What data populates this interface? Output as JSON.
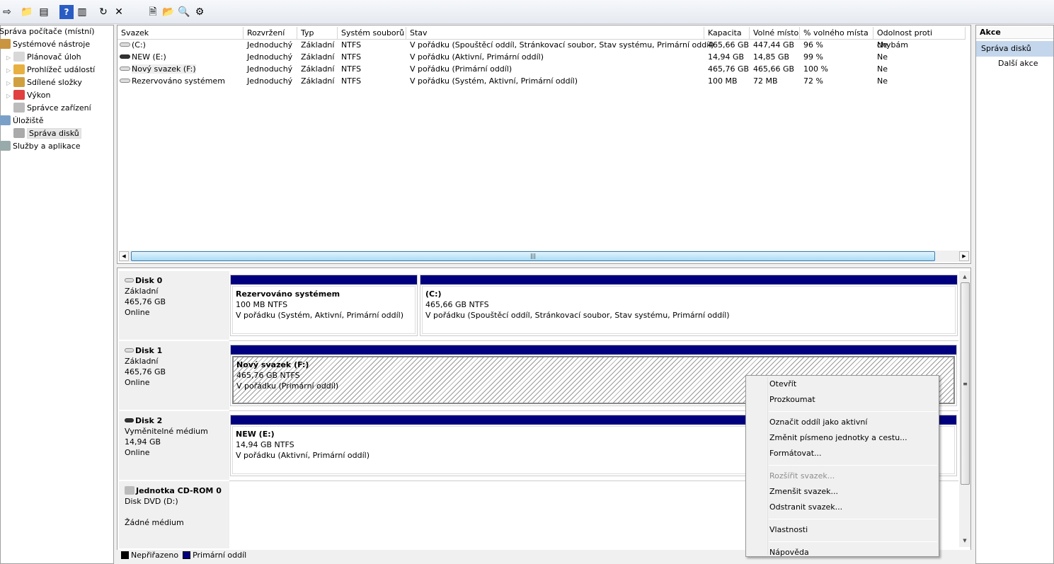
{
  "toolbar": {
    "icons": [
      "forward-arrow-icon",
      "up-folder-icon",
      "show-hide-tree-icon",
      "help-icon",
      "show-hide-action-pane-icon",
      "refresh-icon",
      "delete-icon",
      "properties-icon",
      "open-icon",
      "explore-icon",
      "settings-icon"
    ]
  },
  "tree": {
    "items": [
      {
        "label": "Správa počítače (místní)",
        "level": 0
      },
      {
        "label": "Systémové nástroje",
        "level": 1
      },
      {
        "label": "Plánovač úloh",
        "level": 2,
        "expandable": true
      },
      {
        "label": "Prohlížeč událostí",
        "level": 2,
        "expandable": true
      },
      {
        "label": "Sdílené složky",
        "level": 2,
        "expandable": true
      },
      {
        "label": "Výkon",
        "level": 2,
        "expandable": true
      },
      {
        "label": "Správce zařízení",
        "level": 2
      },
      {
        "label": "Úložiště",
        "level": 1
      },
      {
        "label": "Správa disků",
        "level": 2,
        "selected": true
      },
      {
        "label": "Služby a aplikace",
        "level": 1
      }
    ]
  },
  "volumes": {
    "columns": [
      "Svazek",
      "Rozvržení",
      "Typ",
      "Systém souborů",
      "Stav",
      "Kapacita",
      "Volné místo",
      "% volného místa",
      "Odolnost proti chybám"
    ],
    "rows": [
      [
        "(C:)",
        "Jednoduchý",
        "Základní",
        "NTFS",
        "V pořádku (Spouštěcí oddíl, Stránkovací soubor, Stav systému, Primární oddíl)",
        "465,66 GB",
        "447,44 GB",
        "96 %",
        "Ne"
      ],
      [
        "NEW (E:)",
        "Jednoduchý",
        "Základní",
        "NTFS",
        "V pořádku (Aktivní, Primární oddíl)",
        "14,94 GB",
        "14,85 GB",
        "99 %",
        "Ne"
      ],
      [
        "Nový svazek (F:)",
        "Jednoduchý",
        "Základní",
        "NTFS",
        "V pořádku (Primární oddíl)",
        "465,76 GB",
        "465,66 GB",
        "100 %",
        "Ne"
      ],
      [
        "Rezervováno systémem",
        "Jednoduchý",
        "Základní",
        "NTFS",
        "V pořádku (Systém, Aktivní, Primární oddíl)",
        "100 MB",
        "72 MB",
        "72 %",
        "Ne"
      ]
    ]
  },
  "disks": [
    {
      "name": "Disk 0",
      "type": "Základní",
      "size": "465,76 GB",
      "status": "Online",
      "partitions": [
        {
          "name": "Rezervováno systémem",
          "size": "100 MB NTFS",
          "status": "V pořádku (Systém, Aktivní, Primární oddíl)"
        },
        {
          "name": " (C:)",
          "size": "465,66 GB NTFS",
          "status": "V pořádku (Spouštěcí oddíl, Stránkovací soubor, Stav systému, Primární oddíl)"
        }
      ]
    },
    {
      "name": "Disk 1",
      "type": "Základní",
      "size": "465,76 GB",
      "status": "Online",
      "partitions": [
        {
          "name": "Nový svazek  (F:)",
          "size": "465,76 GB NTFS",
          "status": "V pořádku (Primární oddíl)",
          "selected": true
        }
      ]
    },
    {
      "name": "Disk 2",
      "type": "Vyměnitelné médium",
      "size": "14,94 GB",
      "status": "Online",
      "partitions": [
        {
          "name": "NEW  (E:)",
          "size": "14,94 GB NTFS",
          "status": "V pořádku (Aktivní, Primární oddíl)"
        }
      ]
    },
    {
      "name": "Jednotka CD-ROM 0",
      "type": "Disk DVD (D:)",
      "size": "",
      "status": "Žádné médium",
      "partitions": []
    }
  ],
  "legend": [
    {
      "label": "Nepřiřazeno",
      "color": "#000000"
    },
    {
      "label": "Primární oddíl",
      "color": "#00007f"
    }
  ],
  "actions": {
    "title": "Akce",
    "section": "Správa disků",
    "item": "Další akce"
  },
  "context_menu": {
    "items": [
      {
        "label": "Otevřít"
      },
      {
        "label": "Prozkoumat"
      },
      {
        "sep": true
      },
      {
        "label": "Označit oddíl jako aktivní"
      },
      {
        "label": "Změnit písmeno jednotky a cestu..."
      },
      {
        "label": "Formátovat..."
      },
      {
        "sep": true
      },
      {
        "label": "Rozšířit svazek...",
        "disabled": true
      },
      {
        "label": "Zmenšit svazek..."
      },
      {
        "label": "Odstranit svazek..."
      },
      {
        "sep": true
      },
      {
        "label": "Vlastnosti"
      },
      {
        "sep": true
      },
      {
        "label": "Nápověda"
      }
    ]
  },
  "colors": {
    "primary_partition": "#00007f",
    "selection": "#c4d6ec"
  }
}
